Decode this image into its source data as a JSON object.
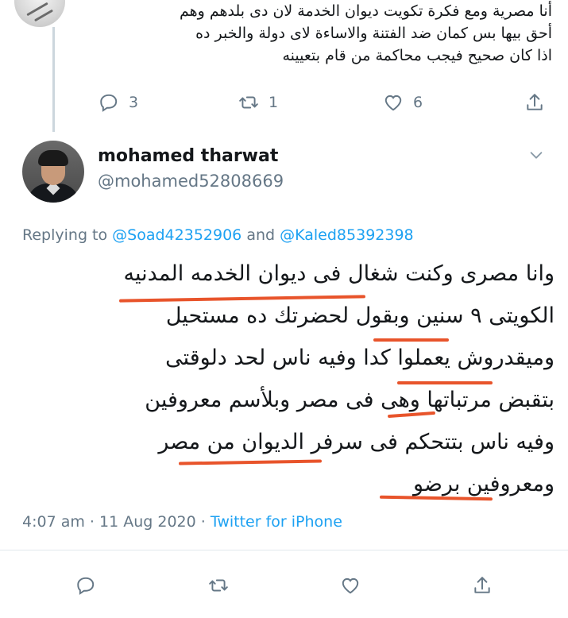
{
  "parent_tweet": {
    "lines": [
      "أنا مصرية ومع فكرة تكويت ديوان الخدمة لان دى بلدهم وهم",
      "أحق بيها بس كمان ضد الفتنة والاساءة لاى دولة والخبر ده",
      "اذا كان صحيح فيجب محاكمة من قام بتعيينه"
    ],
    "actions": {
      "reply_count": "3",
      "retweet_count": "1",
      "like_count": "6"
    }
  },
  "tweet": {
    "author": {
      "name": "mohamed tharwat",
      "handle": "@mohamed52808669"
    },
    "replying": {
      "prefix": "Replying to",
      "user1": "@Soad42352906",
      "joiner": "and",
      "user2": "@Kaled85392398"
    },
    "body_lines": [
      "وانا مصرى وكنت شغال فى ديوان الخدمه المدنيه",
      "الكويتى ٩ سنين وبقول لحضرتك ده مستحيل",
      "وميقدروش يعملوا كدا وفيه ناس لحد دلوقتى",
      "بتقبض مرتباتها وهى فى مصر وبلأسم معروفين",
      "وفيه ناس بتتحكم فى سرفر الديوان من مصر",
      "ومعروفين برضو"
    ],
    "time": "4:07 am",
    "date": "11 Aug 2020",
    "separator": "·",
    "source": "Twitter for iPhone"
  },
  "colors": {
    "link": "#1da1f2",
    "muted": "#657786",
    "annotation": "#e8542b"
  },
  "icons": [
    "reply-icon",
    "retweet-icon",
    "like-icon",
    "share-icon",
    "chevron-down-icon"
  ]
}
